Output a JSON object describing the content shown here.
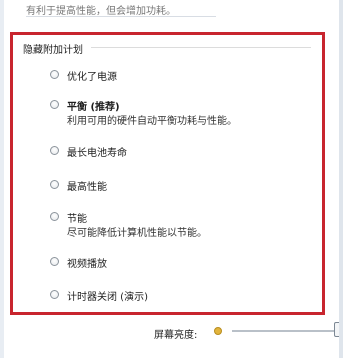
{
  "header": {
    "partial_text": "有利于提高性能，但会增加功耗。"
  },
  "group": {
    "title": "隐藏附加计划"
  },
  "options": [
    {
      "label": "优化了电源",
      "desc": ""
    },
    {
      "label": "平衡 (推荐)",
      "desc": "利用可用的硬件自动平衡功耗与性能。"
    },
    {
      "label": "最长电池寿命",
      "desc": ""
    },
    {
      "label": "最高性能",
      "desc": ""
    },
    {
      "label": "节能",
      "desc": "尽可能降低计算机性能以节能。"
    },
    {
      "label": "视频播放",
      "desc": ""
    },
    {
      "label": "计时器关闭 (演示)",
      "desc": ""
    }
  ],
  "brightness": {
    "label": "屏幕亮度:",
    "level_fraction": 1.0
  },
  "colors": {
    "highlight_border": "#c8252e",
    "accent_sun": "#e2b43c"
  }
}
